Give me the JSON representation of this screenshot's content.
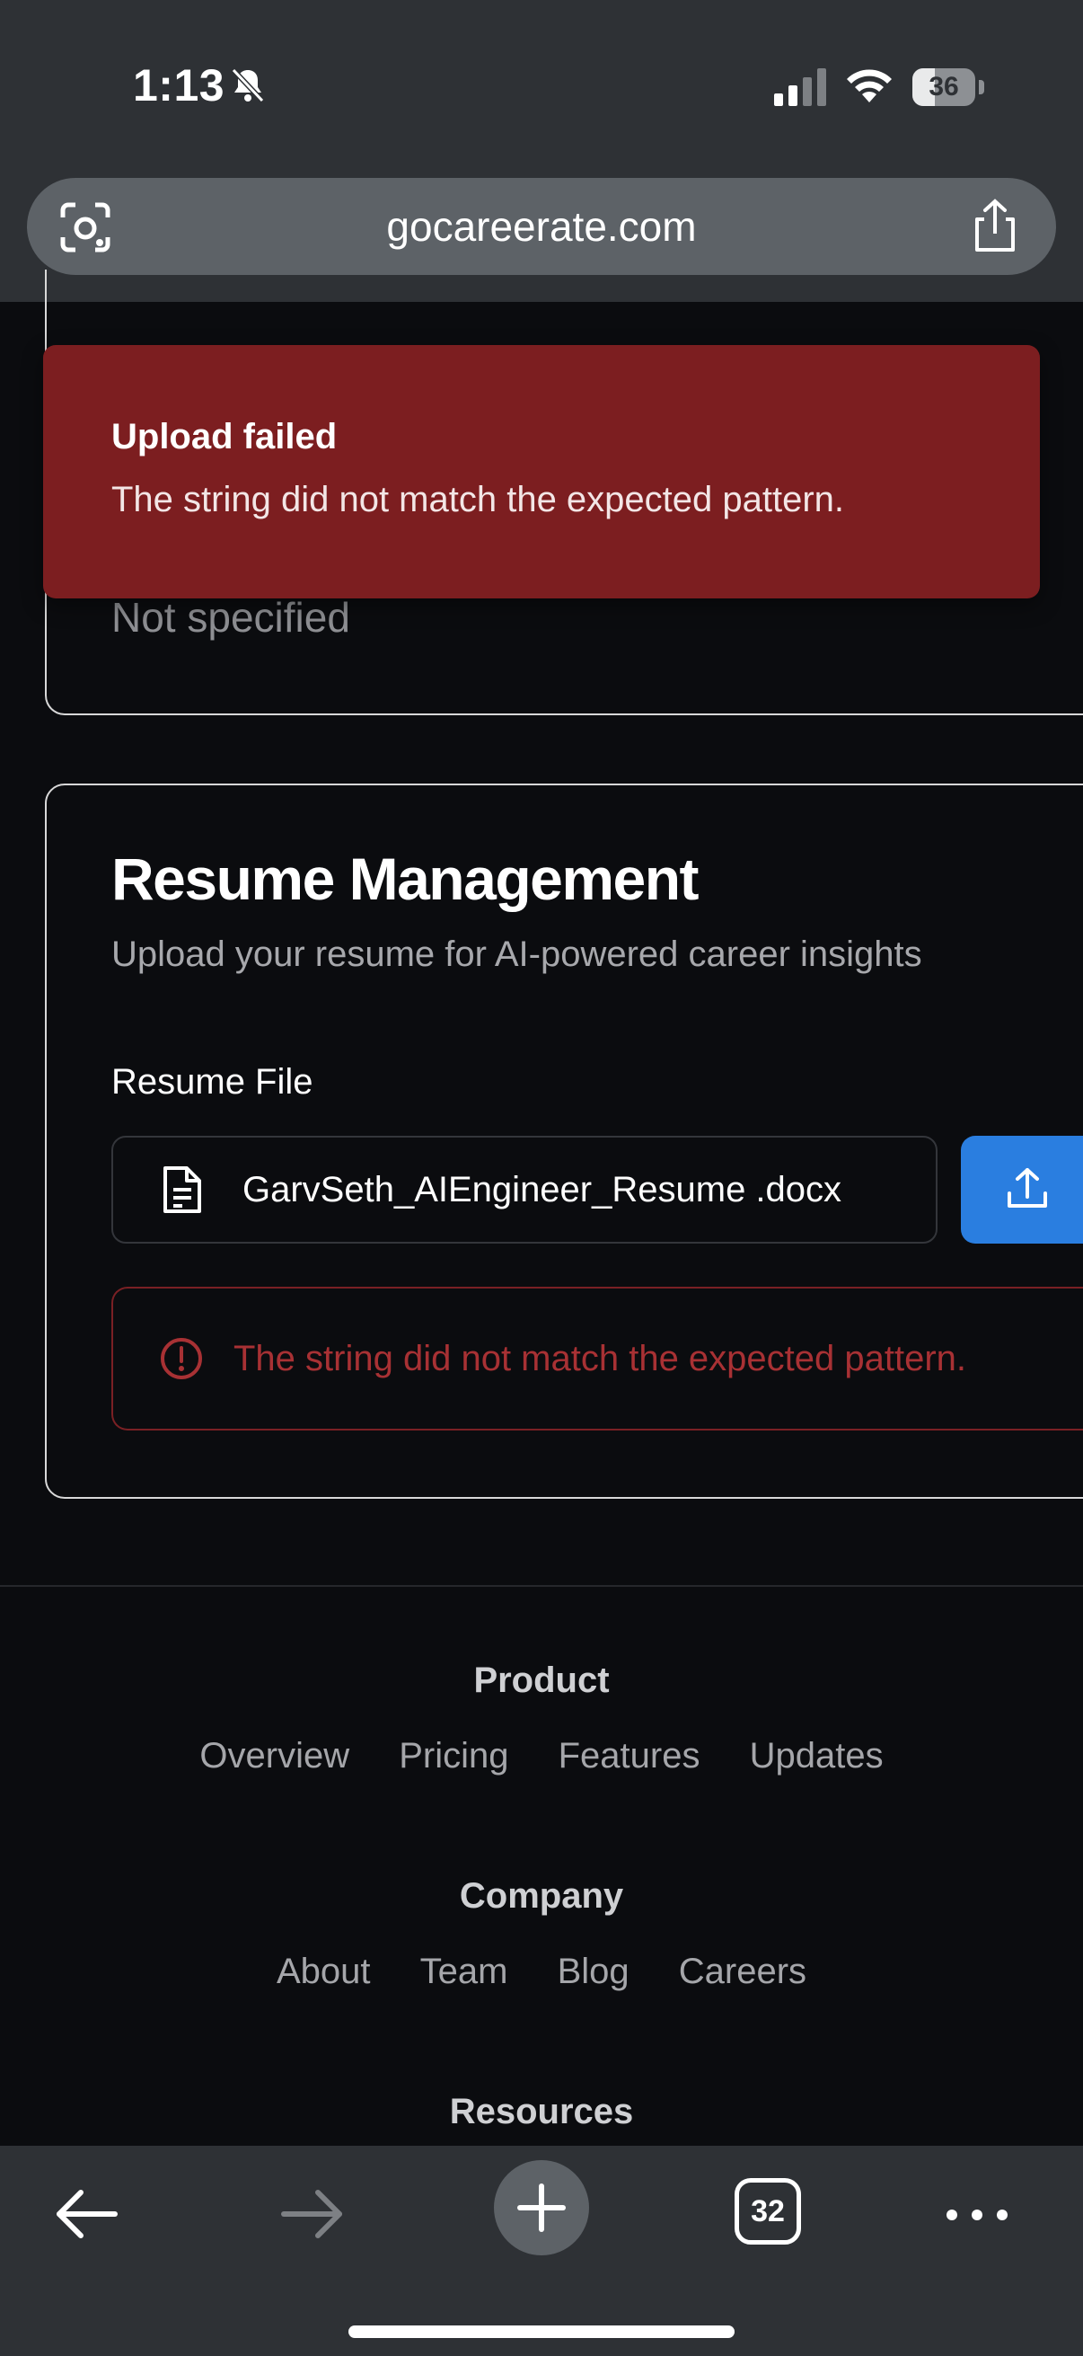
{
  "status_bar": {
    "time": "1:13",
    "battery": "36",
    "battery_level": 0.36
  },
  "browser": {
    "url": "gocareerate.com",
    "tab_count": "32"
  },
  "profile_card": {
    "value": "Not specified"
  },
  "toast": {
    "title": "Upload failed",
    "message": "The string did not match the expected pattern."
  },
  "resume": {
    "title": "Resume Management",
    "subtitle": "Upload your resume for AI-powered career insights",
    "file_label": "Resume File",
    "file_name": "GarvSeth_AIEngineer_Resume .docx",
    "error": "The string did not match the expected pattern."
  },
  "footer": {
    "sections": [
      {
        "heading": "Product",
        "links": [
          "Overview",
          "Pricing",
          "Features",
          "Updates"
        ]
      },
      {
        "heading": "Company",
        "links": [
          "About",
          "Team",
          "Blog",
          "Careers"
        ]
      },
      {
        "heading": "Resources",
        "links": []
      }
    ]
  },
  "colors": {
    "toast_bg": "#7c1e20",
    "error_text": "#a83134",
    "upload_button": "#2a7ee0",
    "page_bg": "#0b0c0f"
  }
}
